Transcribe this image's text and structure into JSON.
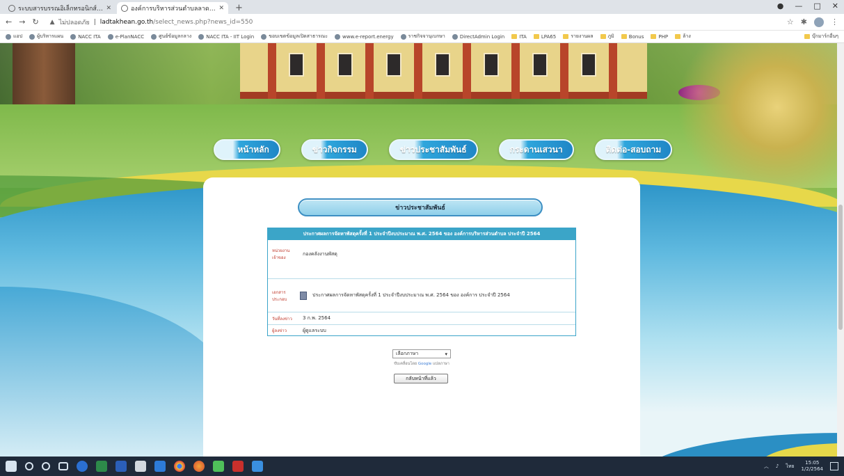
{
  "browser": {
    "tabs": [
      {
        "label": "ระบบสารบรรณอิเล็กทรอนิกส์ Sara…",
        "active": false
      },
      {
        "label": "องค์การบริหารส่วนตำบลลาดตะเคียน",
        "active": true
      }
    ],
    "new_tab": "+",
    "window_controls": {
      "minimize": "—",
      "maximize": "□",
      "close": "✕"
    },
    "address": {
      "warning": "ไม่ปลอดภัย",
      "host": "ladtakhean.go.th",
      "path": "/select_news.php?news_id=550"
    },
    "bookmarks": [
      "แอป",
      "ผู้บริหารแผน",
      "NACC ITA",
      "e-PlanNACC",
      "ศูนย์ข้อมูลกลาง",
      "NACC ITA - IIT Login",
      "ขอบเขตข้อมูลเปิดสาธารณะ",
      "www.e-report.energy",
      "ราชกิจจานุเบกษา",
      "DirectAdmin Login",
      "ITA",
      "LPA65",
      "รายงานผล",
      "ภูมิ",
      "Bonus",
      "PHP",
      "ล้าง"
    ],
    "other_bookmarks": "บุ๊กมาร์กอื่นๆ"
  },
  "nav": {
    "items": [
      "หน้าหลัก",
      "ข่าวกิจกรรม",
      "ข่าวประชาสัมพันธ์",
      "กระดานเสวนา",
      "ติดต่อ-สอบถาม"
    ]
  },
  "content": {
    "section_title": "ข่าวประชาสัมพันธ์",
    "news_title": "ประกาศผลการจัดหาพัสดุครั้งที่ 1 ประจำปีงบประมาณ พ.ศ. 2564 ของ องค์การบริหารส่วนตำบล ประจำปี 2564",
    "agency_label": "หน่วยงานเจ้าของ",
    "agency_value": "กองคลังงานพัสดุ",
    "doc_label": "เอกสารประกอบ",
    "doc_value": "ประกาศผลการจัดหาพัสดุครั้งที่ 1 ประจำปีงบประมาณ พ.ศ. 2564 ของ องค์การ ประจำปี 2564",
    "date_label": "วันที่ลงข่าว",
    "date_value": "3 ก.พ. 2564",
    "author_label": "ผู้ลงข่าว",
    "author_value": "ผู้ดูแลระบบ",
    "language_select": "เลือกภาษา",
    "powered_prefix": "ขับเคลื่อนโดย",
    "powered_google": "Google",
    "powered_suffix": "แปลภาษา",
    "back_button": "กลับหน้าที่แล้ว"
  },
  "taskbar": {
    "time": "15:05",
    "date": "1/2/2564",
    "lang": "ไทย"
  },
  "colors": {
    "nav_blue": "#1f86c6",
    "news_header": "#3ba5c8",
    "label_red": "#c0392b"
  }
}
